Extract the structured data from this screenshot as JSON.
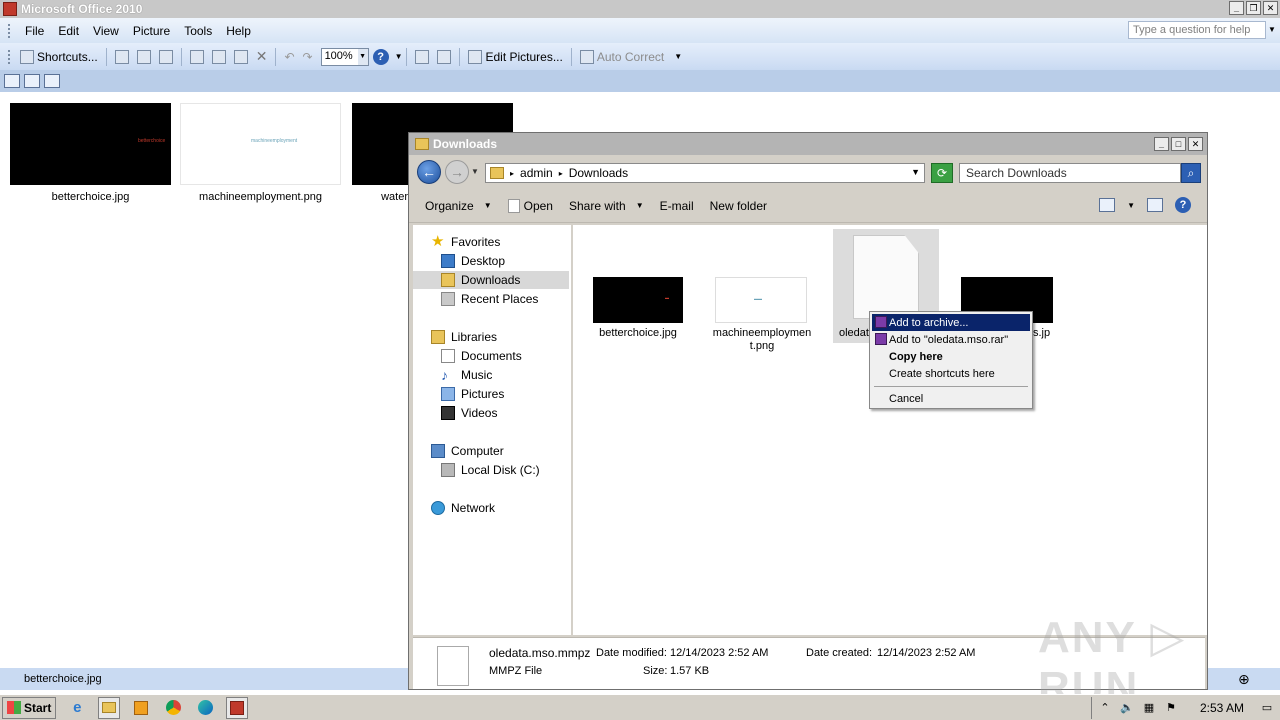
{
  "office": {
    "title": "Microsoft Office 2010",
    "menu": [
      "File",
      "Edit",
      "View",
      "Picture",
      "Tools",
      "Help"
    ],
    "question_placeholder": "Type a question for help",
    "toolbar": {
      "shortcuts": "Shortcuts...",
      "zoom": "100%",
      "edit_pictures": "Edit Pictures...",
      "auto_correct": "Auto Correct"
    },
    "thumbnails": [
      {
        "caption": "betterchoice.jpg",
        "mini": "betterchoice",
        "bg": "#000000",
        "mini_color": "#c0392b"
      },
      {
        "caption": "machineemployment.png",
        "mini": "machineemployment",
        "bg": "#ffffff",
        "mini_color": "#6aa3b8"
      },
      {
        "caption": "water",
        "mini": "",
        "bg": "#000000",
        "mini_color": ""
      }
    ],
    "status": "betterchoice.jpg"
  },
  "explorer": {
    "title": "Downloads",
    "breadcrumb": [
      "admin",
      "Downloads"
    ],
    "search_placeholder": "Search Downloads",
    "commands": [
      "Organize",
      "Open",
      "Share with",
      "E-mail",
      "New folder"
    ],
    "nav": {
      "favorites": "Favorites",
      "desktop": "Desktop",
      "downloads": "Downloads",
      "recent": "Recent Places",
      "libraries": "Libraries",
      "documents": "Documents",
      "music": "Music",
      "pictures": "Pictures",
      "videos": "Videos",
      "computer": "Computer",
      "local_disk": "Local Disk (C:)",
      "network": "Network"
    },
    "files": [
      {
        "name": "betterchoice.jpg"
      },
      {
        "name": "machineemploymen",
        "name2": "t.png"
      },
      {
        "name": "oledat"
      },
      {
        "name": "s.jp"
      }
    ],
    "details": {
      "filename": "oledata.mso.mmpz",
      "type": "MMPZ File",
      "date_modified_label": "Date modified:",
      "date_modified": "12/14/2023 2:52 AM",
      "size_label": "Size:",
      "size": "1.57 KB",
      "date_created_label": "Date created:",
      "date_created": "12/14/2023 2:52 AM"
    }
  },
  "context_menu": {
    "add_archive": "Add to archive...",
    "add_rar": "Add to \"oledata.mso.rar\"",
    "copy_here": "Copy here",
    "create_shortcuts": "Create shortcuts here",
    "cancel": "Cancel"
  },
  "watermark": "ANY ▷ RUN",
  "taskbar": {
    "start": "Start",
    "clock": "2:53 AM"
  }
}
